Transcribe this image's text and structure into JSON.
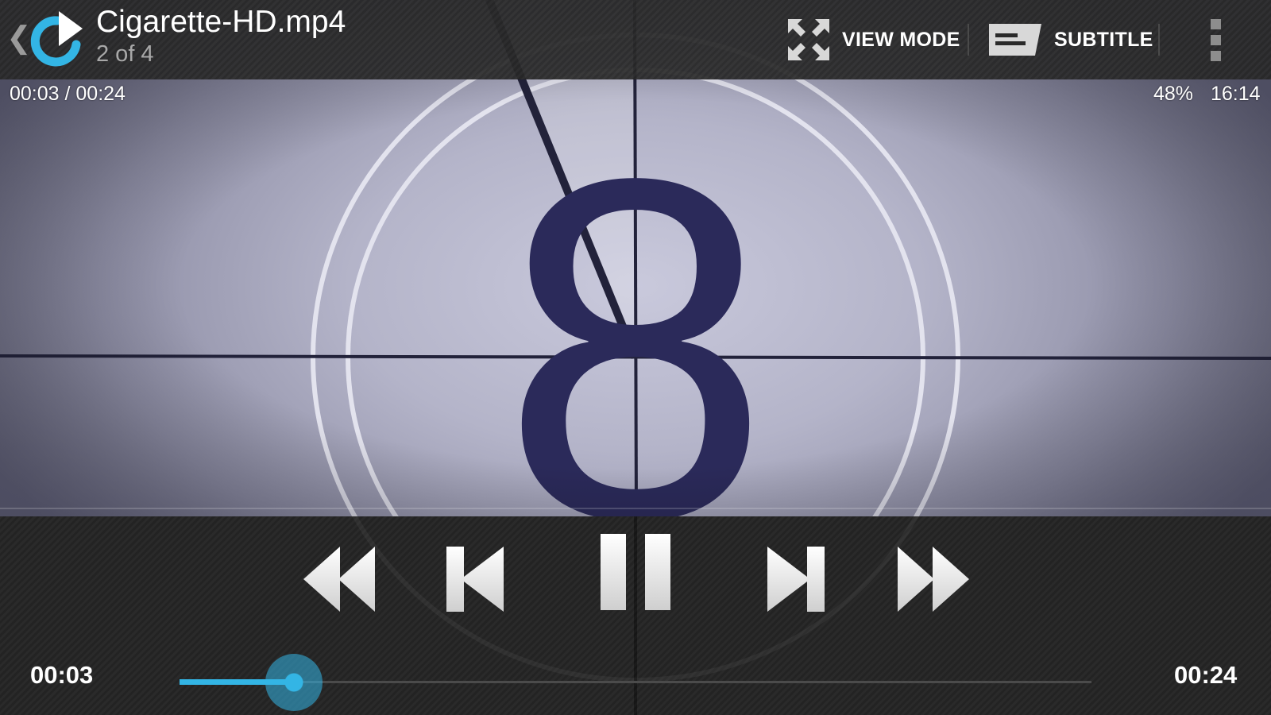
{
  "header": {
    "title": "Cigarette-HD.mp4",
    "playlist_position": "2 of 4",
    "back_icon": "back-chevron-icon",
    "logo_icon": "video-player-logo-icon",
    "view_mode_label": "VIEW MODE",
    "view_mode_icon": "expand-arrows-icon",
    "subtitle_label": "SUBTITLE",
    "subtitle_icon": "subtitle-icon",
    "overflow_icon": "overflow-menu-icon"
  },
  "overlay": {
    "elapsed_total": "00:03 / 00:24",
    "battery": "48%",
    "clock": "16:14"
  },
  "video_frame": {
    "countdown_number": "8"
  },
  "controls": {
    "rewind_icon": "fast-rewind-icon",
    "previous_icon": "skip-previous-icon",
    "pause_icon": "pause-icon",
    "next_icon": "skip-next-icon",
    "forward_icon": "fast-forward-icon",
    "current_time": "00:03",
    "total_time": "00:24",
    "progress": 0.125
  },
  "colors": {
    "accent": "#33b5e5",
    "countdown_ink": "#2b2a5a",
    "bar_background": "#2a2a2a"
  }
}
